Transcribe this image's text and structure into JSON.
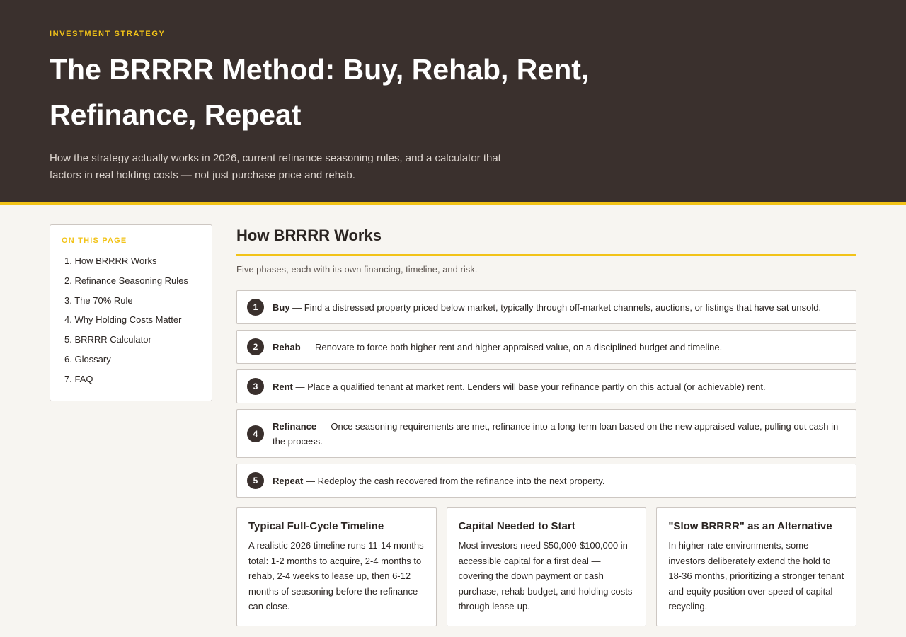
{
  "hero": {
    "eyebrow": "INVESTMENT STRATEGY",
    "title": "The BRRRR Method: Buy, Rehab, Rent, Refinance, Repeat",
    "subtitle": "How the strategy actually works in 2026, current refinance seasoning rules, and a calculator that factors in real holding costs — not just purchase price and rehab."
  },
  "toc": {
    "title": "ON THIS PAGE",
    "items": [
      "1. How BRRRR Works",
      "2. Refinance Seasoning Rules",
      "3. The 70% Rule",
      "4. Why Holding Costs Matter",
      "5. BRRRR Calculator",
      "6. Glossary",
      "7. FAQ"
    ]
  },
  "section": {
    "heading": "How BRRRR Works",
    "lead": "Five phases, each with its own financing, timeline, and risk."
  },
  "steps": [
    {
      "num": "1",
      "name": "Buy",
      "text": " — Find a distressed property priced below market, typically through off-market channels, auctions, or listings that have sat unsold."
    },
    {
      "num": "2",
      "name": "Rehab",
      "text": " — Renovate to force both higher rent and higher appraised value, on a disciplined budget and timeline."
    },
    {
      "num": "3",
      "name": "Rent",
      "text": " — Place a qualified tenant at market rent. Lenders will base your refinance partly on this actual (or achievable) rent."
    },
    {
      "num": "4",
      "name": "Refinance",
      "text": " — Once seasoning requirements are met, refinance into a long-term loan based on the new appraised value, pulling out cash in the process."
    },
    {
      "num": "5",
      "name": "Repeat",
      "text": " — Redeploy the cash recovered from the refinance into the next property."
    }
  ],
  "cards": [
    {
      "title": "Typical Full-Cycle Timeline",
      "body": "A realistic 2026 timeline runs 11-14 months total: 1-2 months to acquire, 2-4 months to rehab, 2-4 weeks to lease up, then 6-12 months of seasoning before the refinance can close."
    },
    {
      "title": "Capital Needed to Start",
      "body": "Most investors need $50,000-$100,000 in accessible capital for a first deal — covering the down payment or cash purchase, rehab budget, and holding costs through lease-up."
    },
    {
      "title": "\"Slow BRRRR\" as an Alternative",
      "body": "In higher-rate environments, some investors deliberately extend the hold to 18-36 months, prioritizing a stronger tenant and equity position over speed of capital recycling."
    }
  ]
}
